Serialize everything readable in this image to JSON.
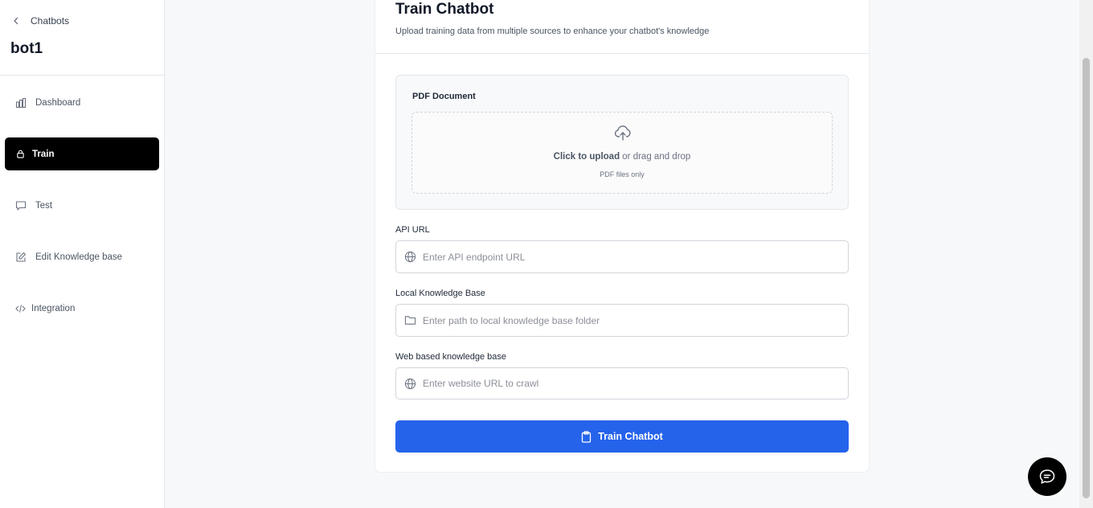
{
  "sidebar": {
    "back_label": "Chatbots",
    "bot_name": "bot1",
    "items": [
      {
        "label": "Dashboard",
        "icon": "bar-chart-icon",
        "active": false
      },
      {
        "label": "Train",
        "icon": "lock-icon",
        "active": true
      },
      {
        "label": "Test",
        "icon": "message-square-icon",
        "active": false
      },
      {
        "label": "Edit Knowledge base",
        "icon": "edit-icon",
        "active": false
      },
      {
        "label": "Integration",
        "icon": "code-icon",
        "active": false
      }
    ]
  },
  "main": {
    "title": "Train Chatbot",
    "subtitle": "Upload training data from multiple sources to enhance your chatbot's knowledge",
    "pdf": {
      "label": "PDF Document",
      "upload_strong": "Click to upload",
      "upload_rest": " or drag and drop",
      "hint": "PDF files only"
    },
    "api_url": {
      "label": "API URL",
      "placeholder": "Enter API endpoint URL",
      "value": ""
    },
    "local_kb": {
      "label": "Local Knowledge Base",
      "placeholder": "Enter path to local knowledge base folder",
      "value": ""
    },
    "web_kb": {
      "label": "Web based knowledge base",
      "placeholder": "Enter website URL to crawl",
      "value": ""
    },
    "train_button": "Train Chatbot"
  },
  "colors": {
    "primary": "#2563eb",
    "active_nav": "#000000",
    "background": "#f7f8fa"
  }
}
